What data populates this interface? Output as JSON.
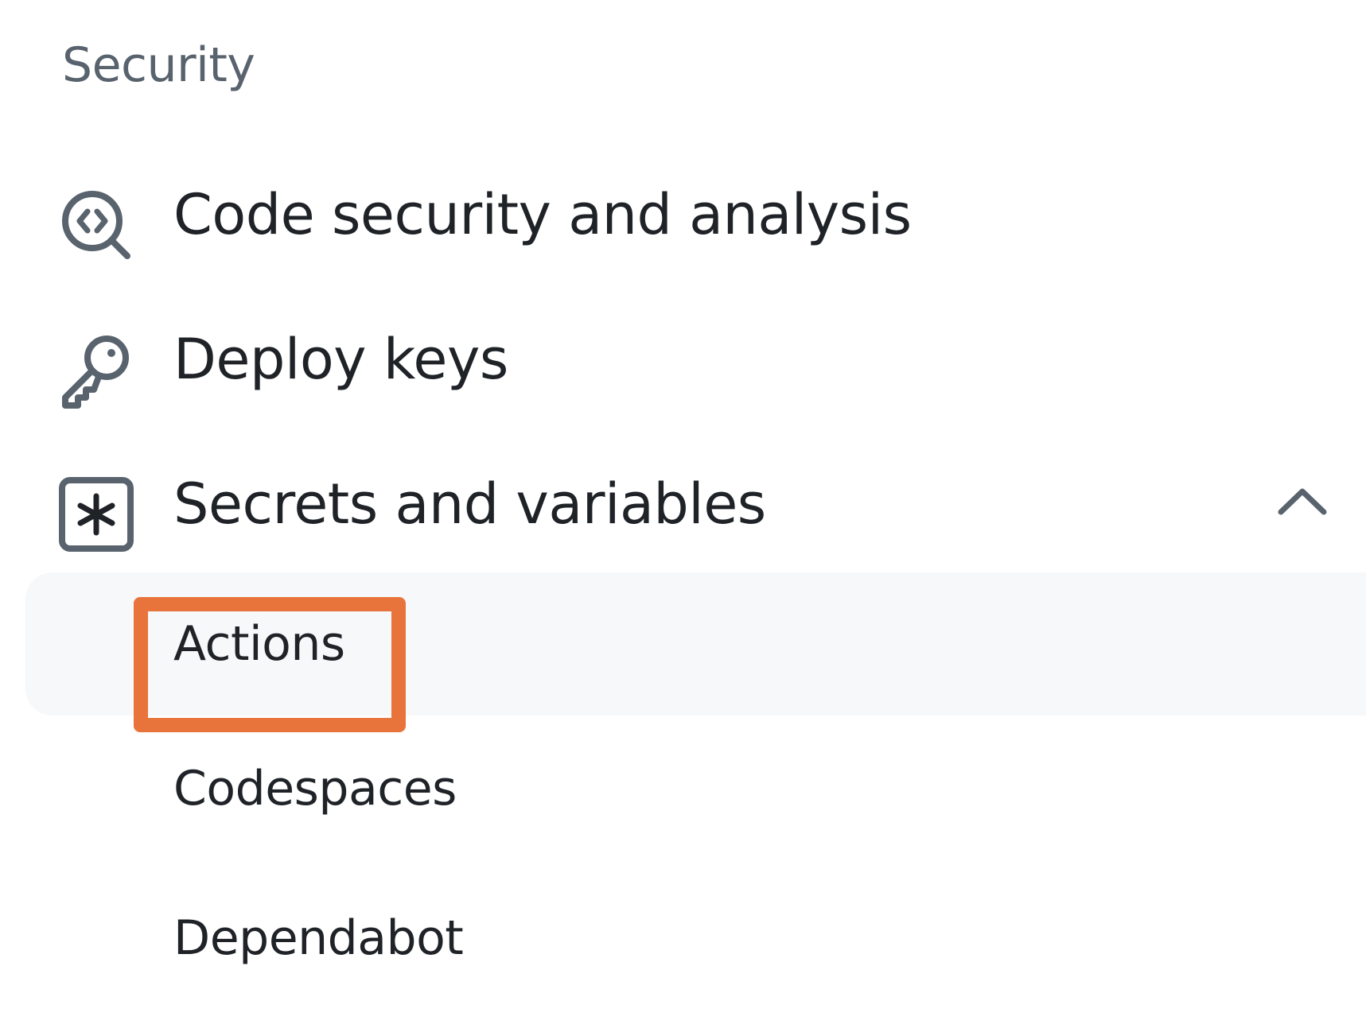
{
  "sidebar": {
    "section_heading": "Security",
    "items": [
      {
        "label": "Code security and analysis",
        "icon": "codescan-icon"
      },
      {
        "label": "Deploy keys",
        "icon": "key-icon"
      },
      {
        "label": "Secrets and variables",
        "icon": "key-asterisk-icon",
        "expanded": true,
        "chevron": "chevron-up-icon"
      }
    ],
    "sub_items": [
      {
        "label": "Actions",
        "selected": true
      },
      {
        "label": "Codespaces",
        "selected": false
      },
      {
        "label": "Dependabot",
        "selected": false
      }
    ]
  },
  "colors": {
    "text": "#1f2328",
    "muted": "#59636e",
    "selected_bg": "#f6f8fa",
    "highlight": "#e8743b"
  }
}
